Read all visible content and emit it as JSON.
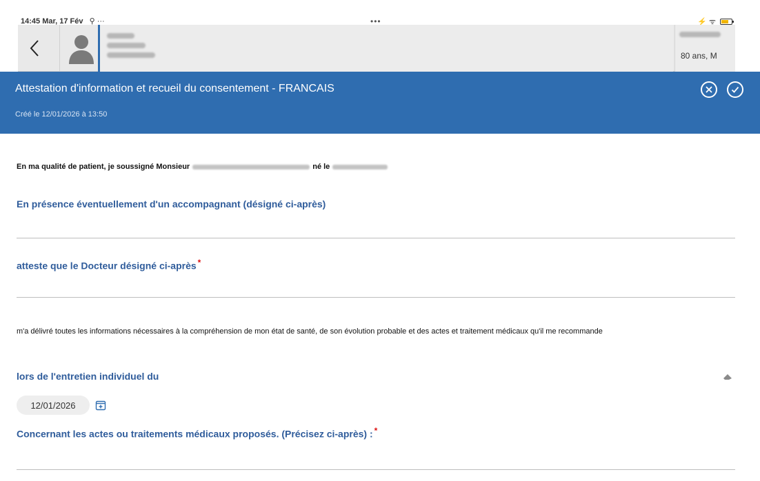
{
  "status_bar": {
    "time_date": "14:45 Mar, 17 Fév",
    "icons_left": "⚲ ···",
    "center_dots": "•••",
    "right_icons": "⚡ ᯤ"
  },
  "patient": {
    "age_sex": "80 ans, M"
  },
  "form": {
    "title": "Attestation d'information et recueil du consentement - FRANCAIS",
    "created": "Créé le 12/01/2026 à 13:50",
    "intro_prefix": "En ma qualité de patient, je soussigné Monsieur",
    "intro_born": "né le",
    "companion_label": "En présence éventuellement d'un accompagnant (désigné ci-après)",
    "doctor_label": "atteste que le Docteur désigné ci-après",
    "required_mark": "*",
    "info_paragraph": "m'a délivré toutes les informations nécessaires à la compréhension de mon état de santé, de son évolution probable et des actes et traitement médicaux qu'il me recommande",
    "interview_label": "lors de l'entretien individuel du",
    "interview_date": "12/01/2026",
    "treatments_label": "Concernant les actes ou traitements médicaux proposés. (Précisez ci-après) :"
  },
  "colors": {
    "primary": "#2f6db0",
    "label": "#2f5c9b",
    "required": "#d11111"
  },
  "icons": {
    "back": "chevron-left-icon",
    "avatar": "person-icon",
    "cancel": "close-circle-icon",
    "validate": "check-circle-icon",
    "eraser": "eraser-icon",
    "calendar": "calendar-icon"
  }
}
